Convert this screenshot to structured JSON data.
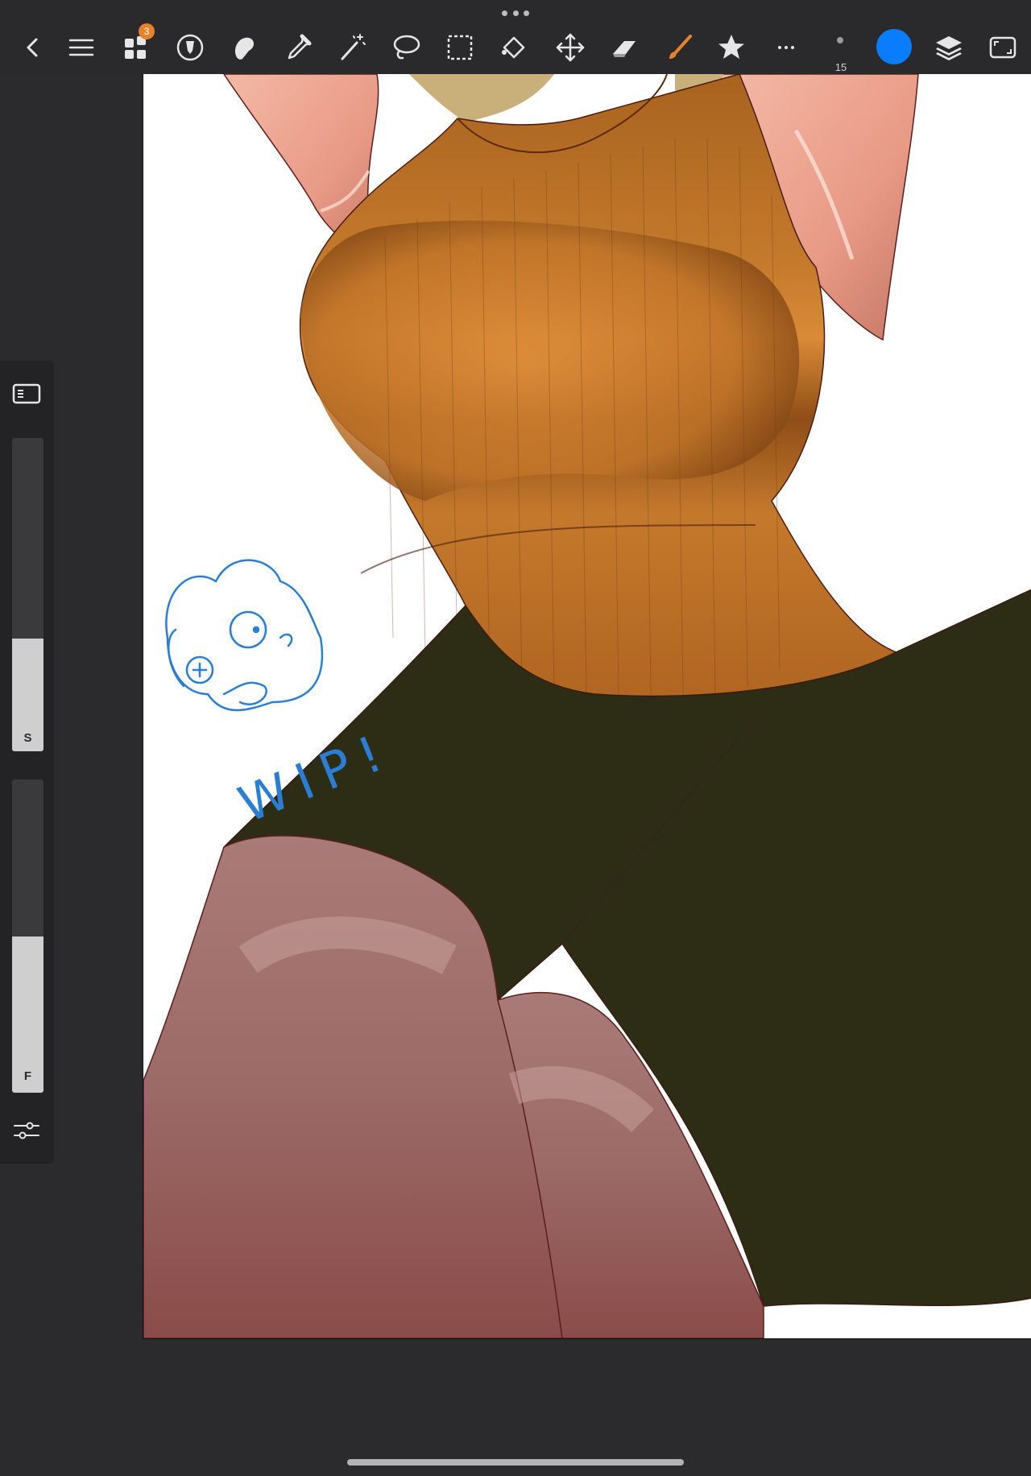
{
  "toolbar": {
    "badge_count": "3",
    "brush_size": "15",
    "current_color": "#0a7dff",
    "icons": [
      "back-icon",
      "menu-icon",
      "gallery-icon",
      "adjust-icon",
      "smudge-icon",
      "eyedropper-icon",
      "magic-wand-icon",
      "lasso-icon",
      "rect-select-icon",
      "transform-icon",
      "move-icon",
      "eraser-icon",
      "brush-icon",
      "star-icon",
      "more-icon",
      "layers-icon",
      "fullscreen-icon"
    ]
  },
  "side_panel": {
    "size_slider_label": "S",
    "size_slider_value": 0.36,
    "flow_slider_label": "F",
    "flow_slider_value": 0.5
  },
  "canvas": {
    "sketch_text": "WIP!"
  }
}
